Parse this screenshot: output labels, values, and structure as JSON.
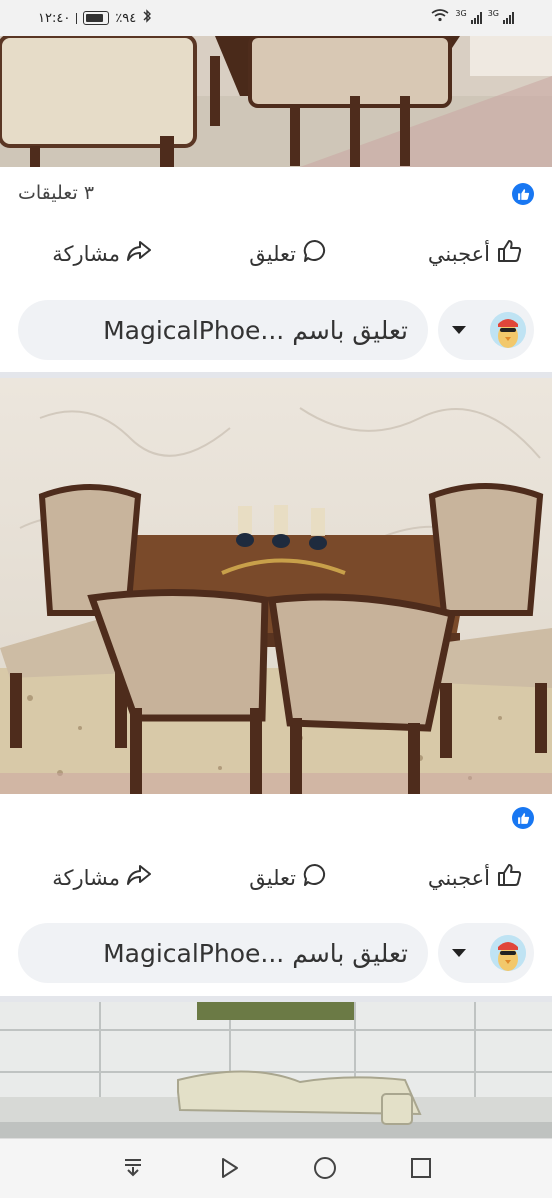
{
  "status_bar": {
    "time": "١٢:٤٠",
    "battery": "٪٩٤",
    "net1": "3G",
    "net2": "3G"
  },
  "posts": [
    {
      "comment_count": "٣ تعليقات",
      "actions": {
        "like": "أعجبني",
        "comment": "تعليق",
        "share": "مشاركة"
      },
      "composer_placeholder": "تعليق باسم ...MagicalPhoe"
    },
    {
      "comment_count": "",
      "actions": {
        "like": "أعجبني",
        "comment": "تعليق",
        "share": "مشاركة"
      },
      "composer_placeholder": "تعليق باسم ...MagicalPhoe"
    }
  ],
  "colors": {
    "brand": "#1877f2",
    "field_bg": "#f0f2f5",
    "divider": "#e4e6eb"
  },
  "icons": [
    "like-icon",
    "comment-icon",
    "share-icon",
    "like-badge-icon",
    "avatar",
    "caret-down-icon",
    "collapse-icon",
    "back-icon",
    "home-icon",
    "recents-icon"
  ]
}
